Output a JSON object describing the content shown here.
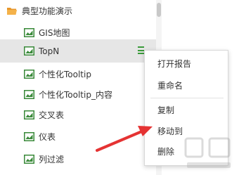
{
  "tree": {
    "root": {
      "label": "典型功能演示",
      "icon": "folder-icon"
    },
    "items": [
      {
        "label": "GIS地图",
        "icon": "report-icon"
      },
      {
        "label": "TopN",
        "icon": "report-icon",
        "selected": true
      },
      {
        "label": "个性化Tooltip",
        "icon": "report-icon"
      },
      {
        "label": "个性化Tooltip_内容",
        "icon": "report-icon"
      },
      {
        "label": "交叉表",
        "icon": "report-icon"
      },
      {
        "label": "仪表",
        "icon": "report-icon"
      },
      {
        "label": "列过滤",
        "icon": "report-icon"
      }
    ]
  },
  "context_menu": {
    "items": [
      {
        "label": "打开报告"
      },
      {
        "label": "重命名"
      },
      {
        "label": "复制"
      },
      {
        "label": "移动到"
      },
      {
        "label": "删除"
      }
    ]
  },
  "colors": {
    "folder": "#f2a53a",
    "report_icon": "#3a8a3a",
    "more_icon": "#3a9a3a",
    "selected_row": "#e6e6e6",
    "arrow": "#e53333"
  }
}
